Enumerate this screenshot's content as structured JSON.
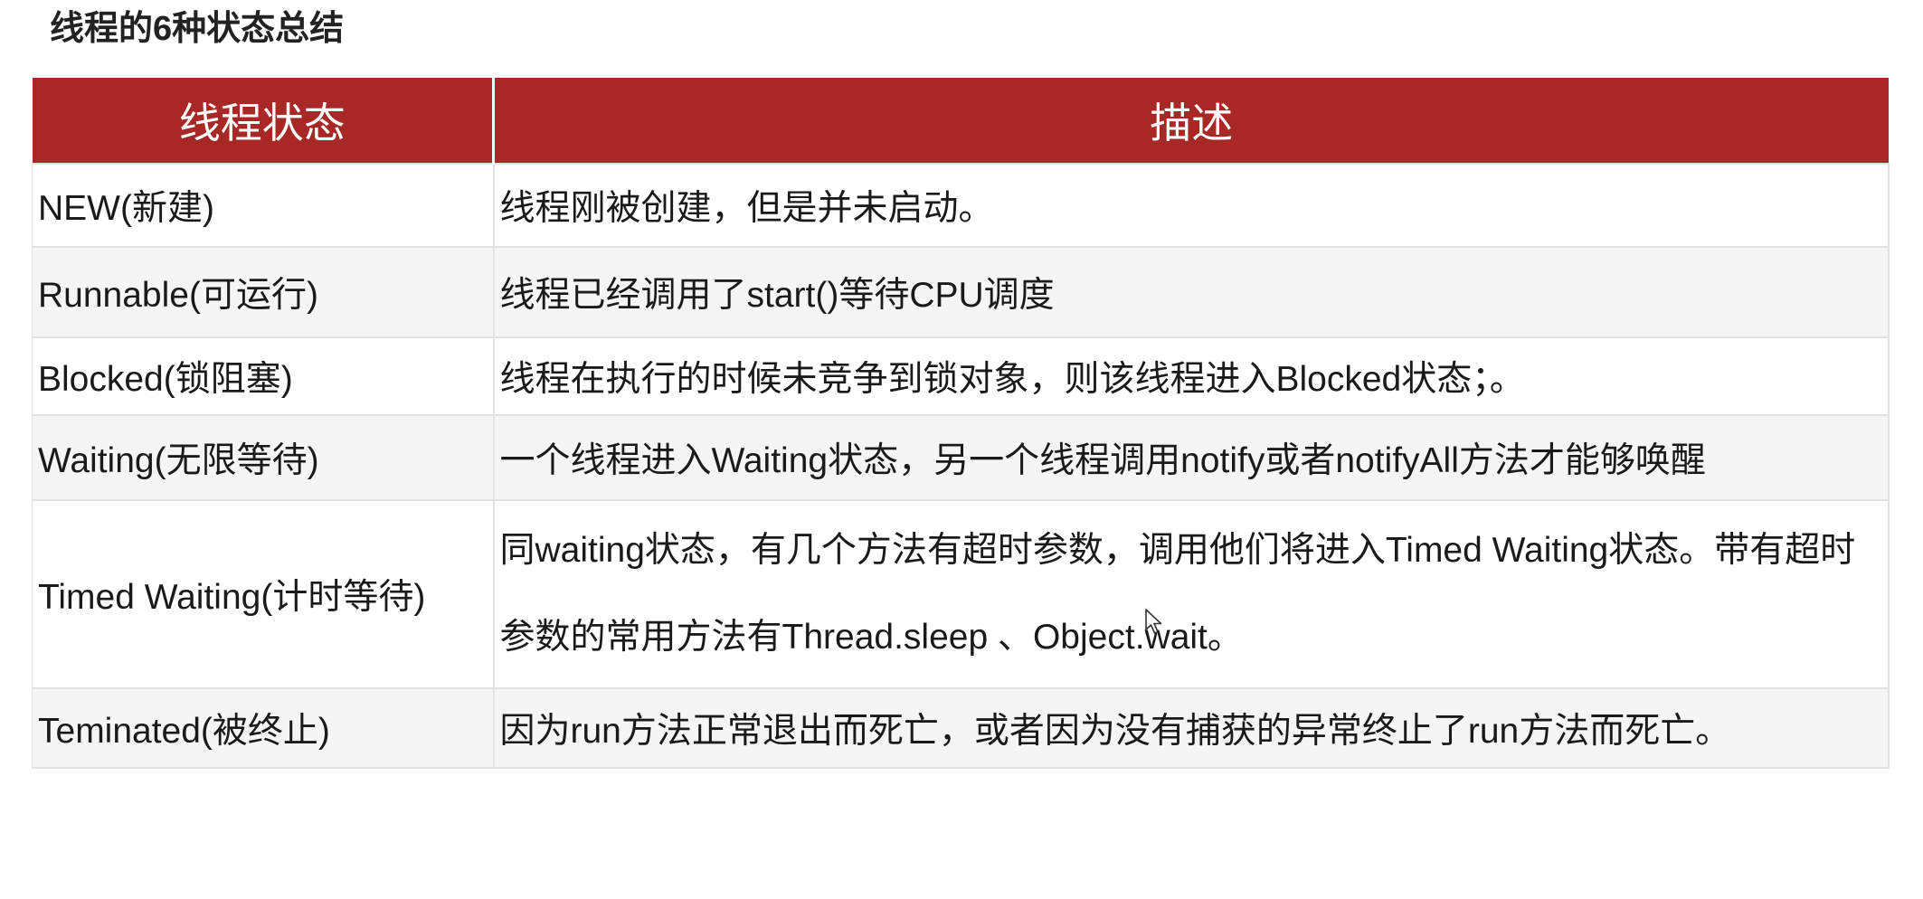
{
  "title": "线程的6种状态总结",
  "table": {
    "headers": [
      "线程状态",
      "描述"
    ],
    "rows": [
      {
        "state": "NEW(新建)",
        "desc": "线程刚被创建，但是并未启动。"
      },
      {
        "state": "Runnable(可运行)",
        "desc": "线程已经调用了start()等待CPU调度"
      },
      {
        "state": "Blocked(锁阻塞)",
        "desc": "线程在执行的时候未竞争到锁对象，则该线程进入Blocked状态；。"
      },
      {
        "state": "Waiting(无限等待)",
        "desc": "一个线程进入Waiting状态，另一个线程调用notify或者notifyAll方法才能够唤醒"
      },
      {
        "state": "Timed Waiting(计时等待)",
        "desc": "同waiting状态，有几个方法有超时参数，调用他们将进入Timed Waiting状态。带有超时参数的常用方法有Thread.sleep 、Object.wait。"
      },
      {
        "state": "Teminated(被终止)",
        "desc": "因为run方法正常退出而死亡，或者因为没有捕获的异常终止了run方法而死亡。"
      }
    ]
  },
  "icons": {
    "cursor": "mouse-pointer-icon"
  }
}
